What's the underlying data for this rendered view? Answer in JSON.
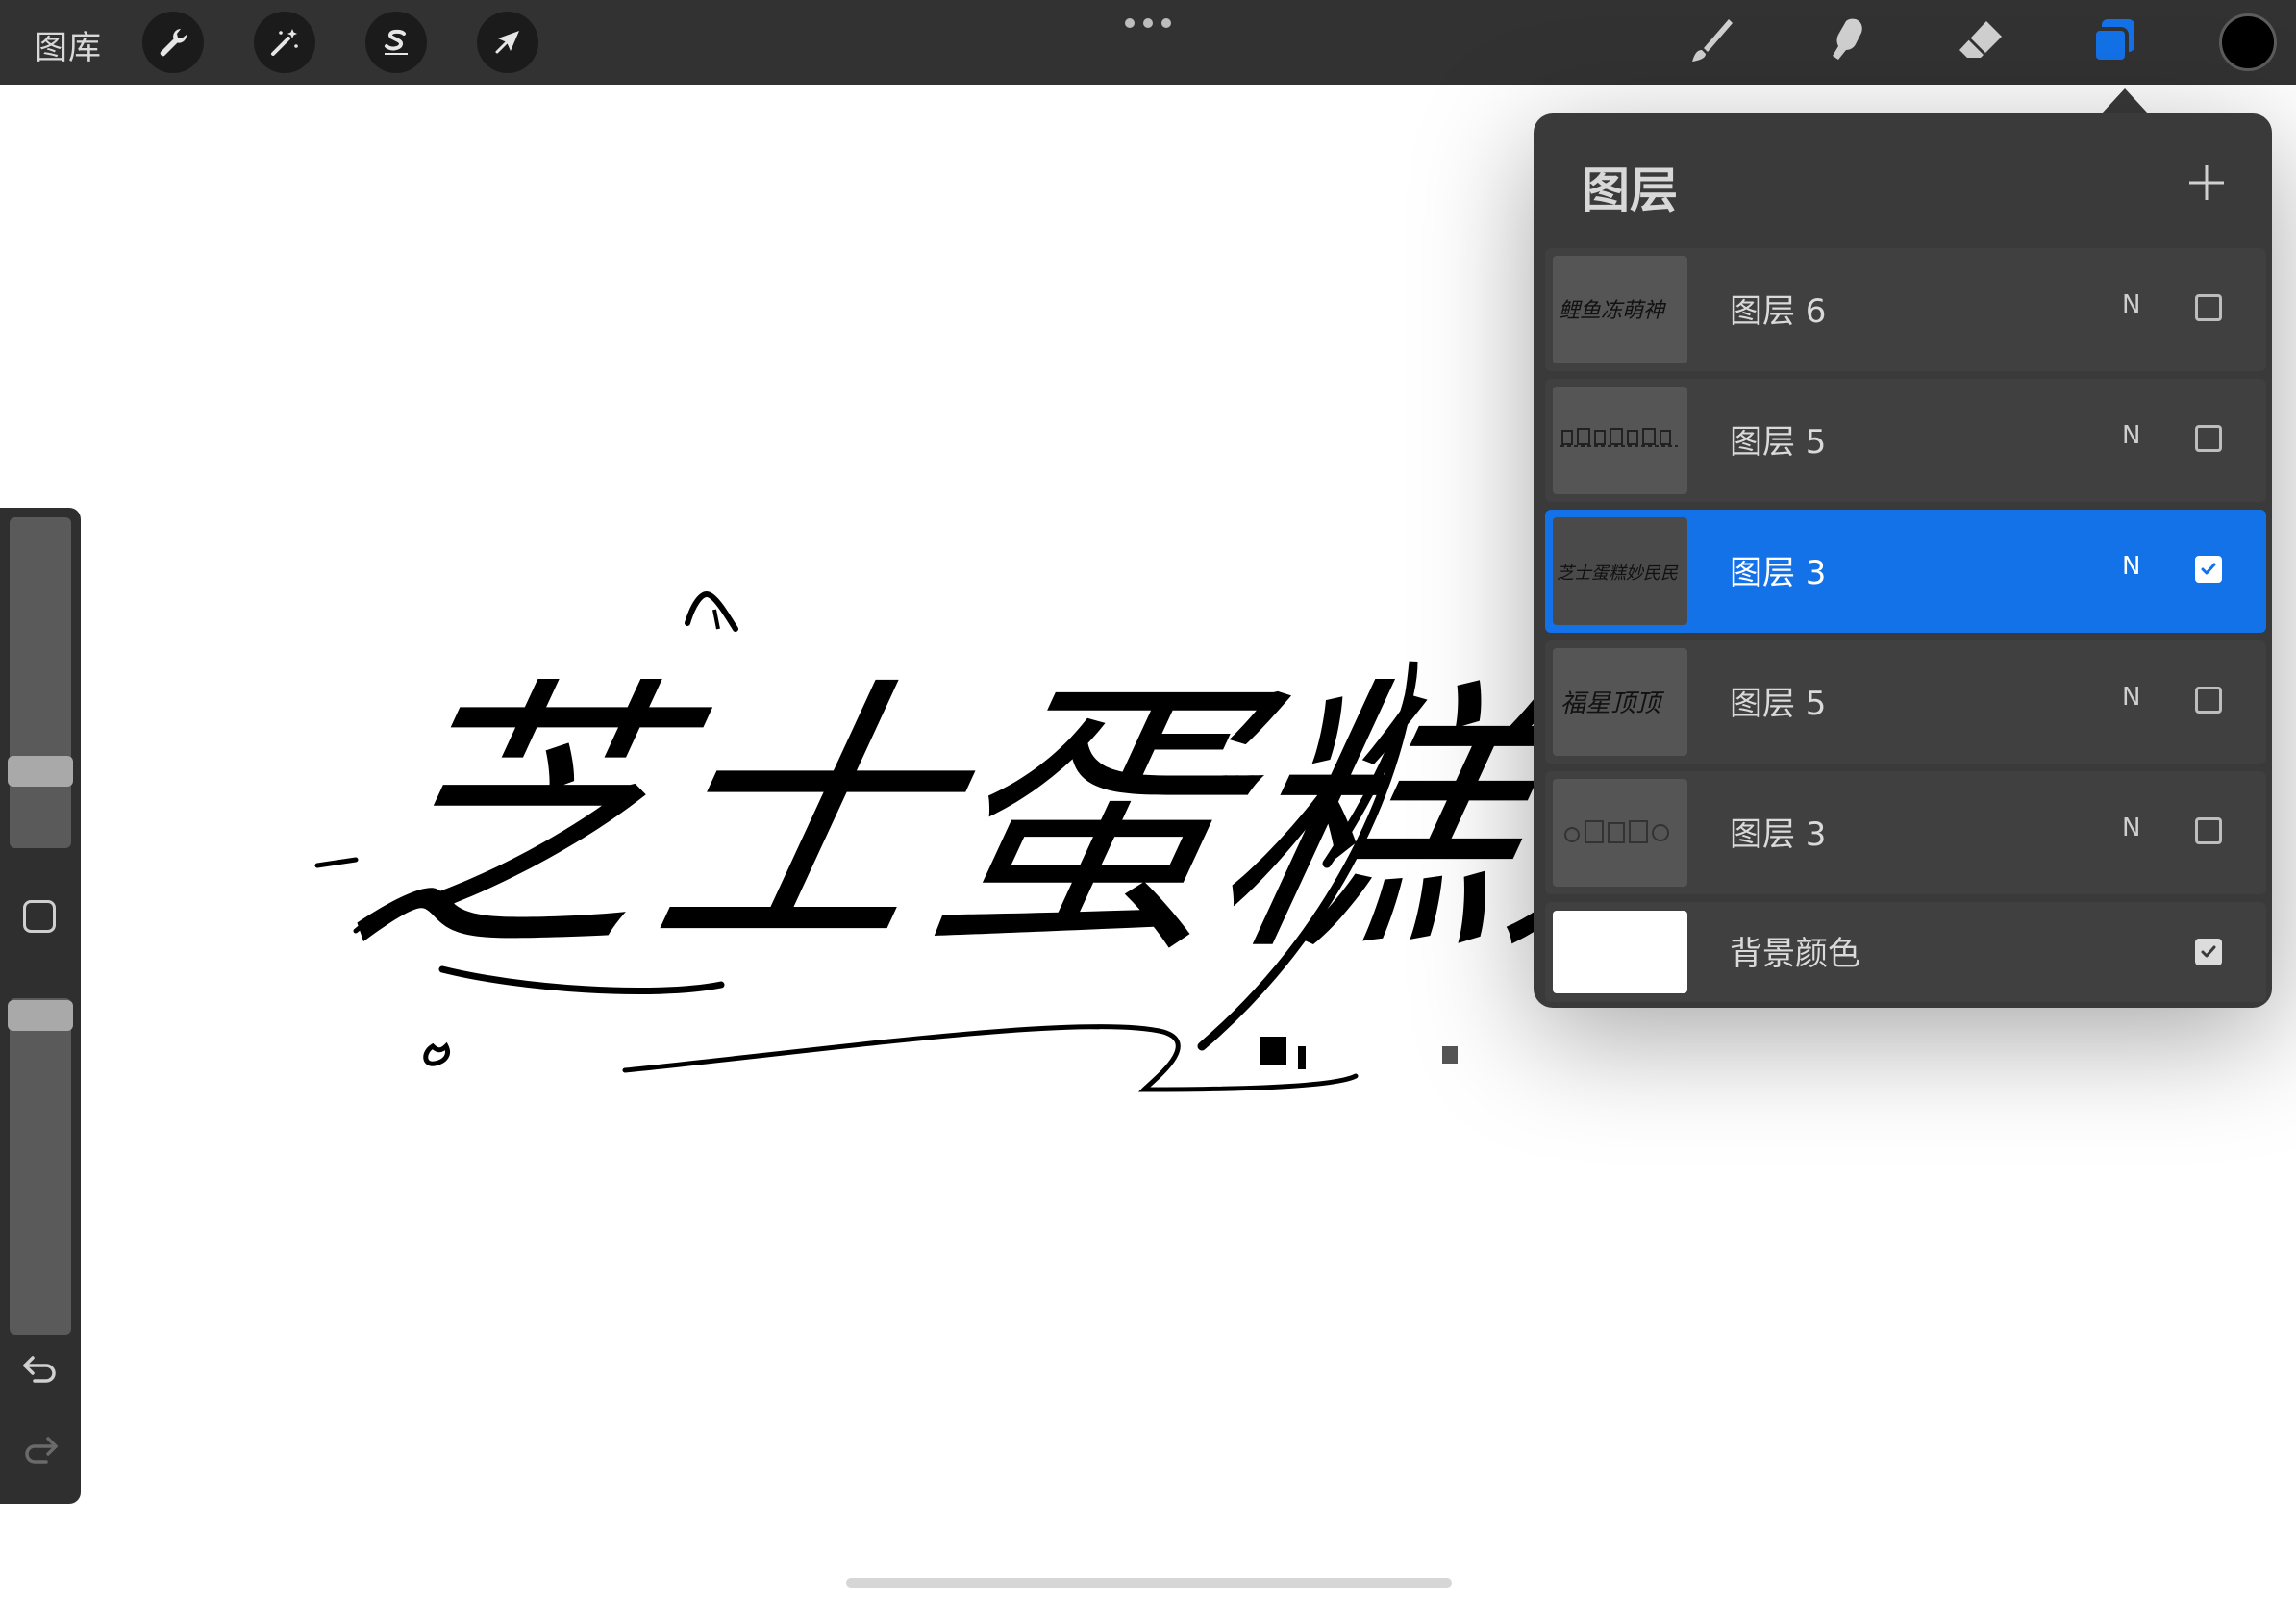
{
  "toolbar": {
    "gallery_label": "图库",
    "left_tools": [
      {
        "name": "actions",
        "icon": "wrench-icon"
      },
      {
        "name": "adjustments",
        "icon": "magic-wand-icon"
      },
      {
        "name": "selection",
        "icon": "selection-s-icon"
      },
      {
        "name": "transform",
        "icon": "arrow-cursor-icon"
      }
    ],
    "right_tools": [
      {
        "name": "brush",
        "icon": "brush-icon"
      },
      {
        "name": "smudge",
        "icon": "smudge-finger-icon"
      },
      {
        "name": "eraser",
        "icon": "eraser-icon"
      },
      {
        "name": "layers",
        "icon": "layers-icon",
        "active": true
      }
    ],
    "current_color": "#000000",
    "accent_color": "#1372e8"
  },
  "layers_panel": {
    "title": "图层",
    "add_button_icon": "plus-icon",
    "layers": [
      {
        "name": "图层 6",
        "blend": "N",
        "visible": false,
        "selected": false,
        "thumb_text": "鲤鱼冻萌神"
      },
      {
        "name": "图层 5",
        "blend": "N",
        "visible": false,
        "selected": false,
        "thumb_text": ""
      },
      {
        "name": "图层 3",
        "blend": "N",
        "visible": true,
        "selected": true,
        "thumb_text": "芝士蛋糕妙民民"
      },
      {
        "name": "图层 5",
        "blend": "N",
        "visible": false,
        "selected": false,
        "thumb_text": "福星顶顶"
      },
      {
        "name": "图层 3",
        "blend": "N",
        "visible": false,
        "selected": false,
        "thumb_text": ""
      }
    ],
    "background": {
      "name": "背景颜色",
      "visible": true,
      "color": "#ffffff"
    }
  },
  "canvas": {
    "artwork_text": "芝士蛋糕妙"
  },
  "sidebar": {
    "brush_size_level": 0.7,
    "opacity_level": 0.96
  }
}
